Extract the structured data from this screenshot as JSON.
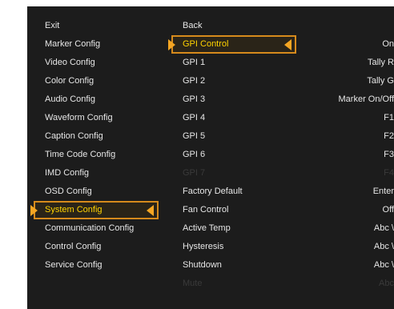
{
  "menu_left": [
    {
      "label": "Exit"
    },
    {
      "label": "Marker Config"
    },
    {
      "label": "Video Config"
    },
    {
      "label": "Color Config"
    },
    {
      "label": "Audio Config"
    },
    {
      "label": "Waveform Config"
    },
    {
      "label": "Caption Config"
    },
    {
      "label": "Time Code Config"
    },
    {
      "label": "IMD Config"
    },
    {
      "label": "OSD Config"
    },
    {
      "label": "System Config"
    },
    {
      "label": "Communication Config"
    },
    {
      "label": "Control Config"
    },
    {
      "label": "Service Config"
    }
  ],
  "menu_mid": [
    {
      "label": "Back"
    },
    {
      "label": "GPI Control"
    },
    {
      "label": "GPI 1"
    },
    {
      "label": "GPI 2"
    },
    {
      "label": "GPI 3"
    },
    {
      "label": "GPI 4"
    },
    {
      "label": "GPI 5"
    },
    {
      "label": "GPI 6"
    },
    {
      "label": "GPI 7"
    },
    {
      "label": "Factory Default"
    },
    {
      "label": "Fan Control"
    },
    {
      "label": "Active Temp"
    },
    {
      "label": "Hysteresis"
    },
    {
      "label": "Shutdown"
    },
    {
      "label": "Mute"
    }
  ],
  "menu_values": [
    {
      "value": ""
    },
    {
      "value": "On"
    },
    {
      "value": "Tally R"
    },
    {
      "value": "Tally G"
    },
    {
      "value": "Marker On/Off"
    },
    {
      "value": "F1"
    },
    {
      "value": "F2"
    },
    {
      "value": "F3"
    },
    {
      "value": "F4"
    },
    {
      "value": "Enter"
    },
    {
      "value": "Off"
    },
    {
      "value": "Abc \\"
    },
    {
      "value": "Abc \\"
    },
    {
      "value": "Abc \\"
    },
    {
      "value": "Abc"
    }
  ],
  "colors": {
    "highlight_text": "#ffd200",
    "highlight_border": "#d68a1c",
    "arrow": "#f5a623",
    "background": "#1c1c1c"
  }
}
